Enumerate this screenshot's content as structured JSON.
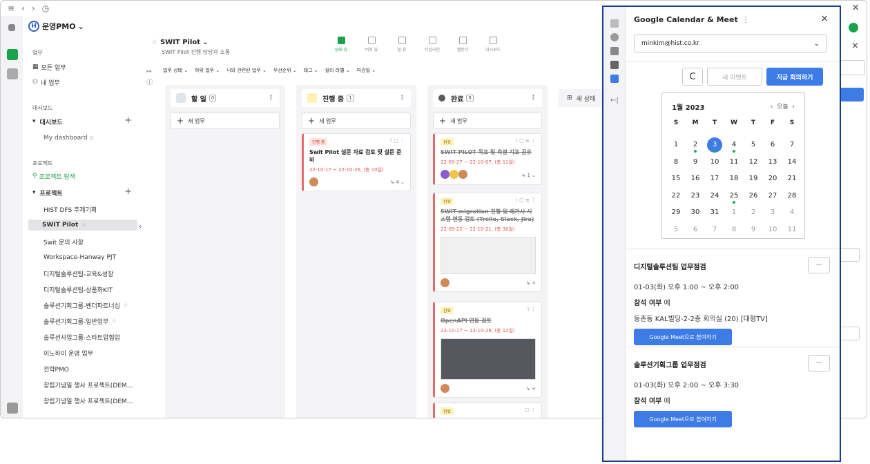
{
  "workspace": {
    "name": "운영PMO",
    "logo_letter": "H"
  },
  "sidebar": {
    "sections": [
      {
        "label": "업무"
      },
      {
        "label": "대시보드"
      },
      {
        "label": "프로젝트"
      }
    ],
    "items": [
      {
        "label": "모든 업무"
      },
      {
        "label": "내 업무"
      },
      {
        "label": "대시보드"
      },
      {
        "label": "My dashboard"
      },
      {
        "label": "프로젝트 탐색"
      },
      {
        "label": "프로젝트"
      },
      {
        "label": "HIST DFS 주제기획"
      },
      {
        "label": "SWIT Pilot"
      },
      {
        "label": "Swit 문의 사항"
      },
      {
        "label": "Workspace-Hanway PJT"
      },
      {
        "label": "디지털솔루션팀-교육&성장"
      },
      {
        "label": "디지털솔루션팀-상품화KIT"
      },
      {
        "label": "솔루션기획그룹-벤더파트너십"
      },
      {
        "label": "솔루션기획그룹-일반업무"
      },
      {
        "label": "솔루션사업그룹-스타트업협업"
      },
      {
        "label": "이노하이 운영 업무"
      },
      {
        "label": "전략PMO"
      },
      {
        "label": "창립기념일 행사 프로젝트(DEM..."
      },
      {
        "label": "창립기념일 행사 프로젝트(DEM..."
      }
    ]
  },
  "project": {
    "title": "SWIT Pilot",
    "subtitle": "SWIT Pilot 진행 담당자 소통"
  },
  "views": [
    {
      "label": "상태 뷰"
    },
    {
      "label": "버킷 뷰"
    },
    {
      "label": "팀 뷰"
    },
    {
      "label": "타임라인"
    },
    {
      "label": "캘린더"
    },
    {
      "label": "대시보드"
    }
  ],
  "filters": [
    "업무 상태",
    "하위 업무",
    "나와 관련된 업무",
    "우선순위",
    "태그",
    "컬러 라벨",
    "마감일"
  ],
  "board": {
    "new_task_label": "새 업무",
    "new_status_label": "새 상태",
    "columns": [
      {
        "name": "할 일",
        "count": "0",
        "color": "#dfe3ea"
      },
      {
        "name": "진행 중",
        "count": "1",
        "color": "#fff0b3"
      },
      {
        "name": "완료",
        "count": "8",
        "color": "#5b5b5b"
      }
    ],
    "cards": [
      {
        "badge": "진행 중",
        "title": "Swit Pilot 설문 자료 검토 및 설문 준비",
        "date": "22-10-17 ~ 22-10-26, (총 10일)",
        "sub": "4"
      },
      {
        "badge": "완료",
        "title": "SWIT PILOT 목표 및 측정 지표 공유",
        "date": "22-09-27 ~ 22-10-07, (총 11일)",
        "sub": "1"
      },
      {
        "badge": "완료",
        "title": "SWIT migration 진행 및 레거시 시스템 연동 검토 (Trello, Slack, Jira)",
        "date": "22-09-22 ~ 22-10-21, (총 30일)"
      },
      {
        "badge": "완료",
        "title": "OpenAPI 연동 검토",
        "date": "22-10-17 ~ 22-10-28, (총 12일)"
      },
      {
        "badge": "완료"
      }
    ]
  },
  "gcal": {
    "title": "Google Calendar & Meet",
    "account": "minkim@hist.co.kr",
    "refresh_label": "C",
    "new_event_label": "새 이벤트",
    "meet_now_label": "지금 회의하기",
    "month": "1월 2023",
    "today_label": "오늘",
    "weekdays": [
      "S",
      "M",
      "T",
      "W",
      "T",
      "F",
      "S"
    ],
    "days": [
      "1",
      "2",
      "3",
      "4",
      "5",
      "6",
      "7",
      "8",
      "9",
      "10",
      "11",
      "12",
      "13",
      "14",
      "15",
      "16",
      "17",
      "18",
      "19",
      "20",
      "21",
      "22",
      "23",
      "24",
      "25",
      "26",
      "27",
      "28",
      "29",
      "30",
      "31",
      "1",
      "2",
      "3",
      "4",
      "5",
      "6",
      "7",
      "8",
      "9",
      "10",
      "11"
    ],
    "events": [
      {
        "title": "디지털솔루션팀 업무점검",
        "time": "01-03(화) 오후 1:00 ~ 오후 2:00",
        "attend": "참석 여부",
        "attend_value": "예",
        "location": "등촌동 KAL빌딩-2-2층 회의실 (20) [대형TV]",
        "meet_label": "Google Meet으로 참여하기"
      },
      {
        "title": "솔루션기획그룹 업무점검",
        "time": "01-03(화) 오후 2:00 ~ 오후 3:30",
        "attend": "참석 여부",
        "attend_value": "예",
        "meet_label": "Google Meet으로 참여하기"
      }
    ]
  },
  "colors": {
    "accent": "#3d7be6",
    "green": "#1aa34a",
    "panel_border": "#1a3a8c"
  }
}
